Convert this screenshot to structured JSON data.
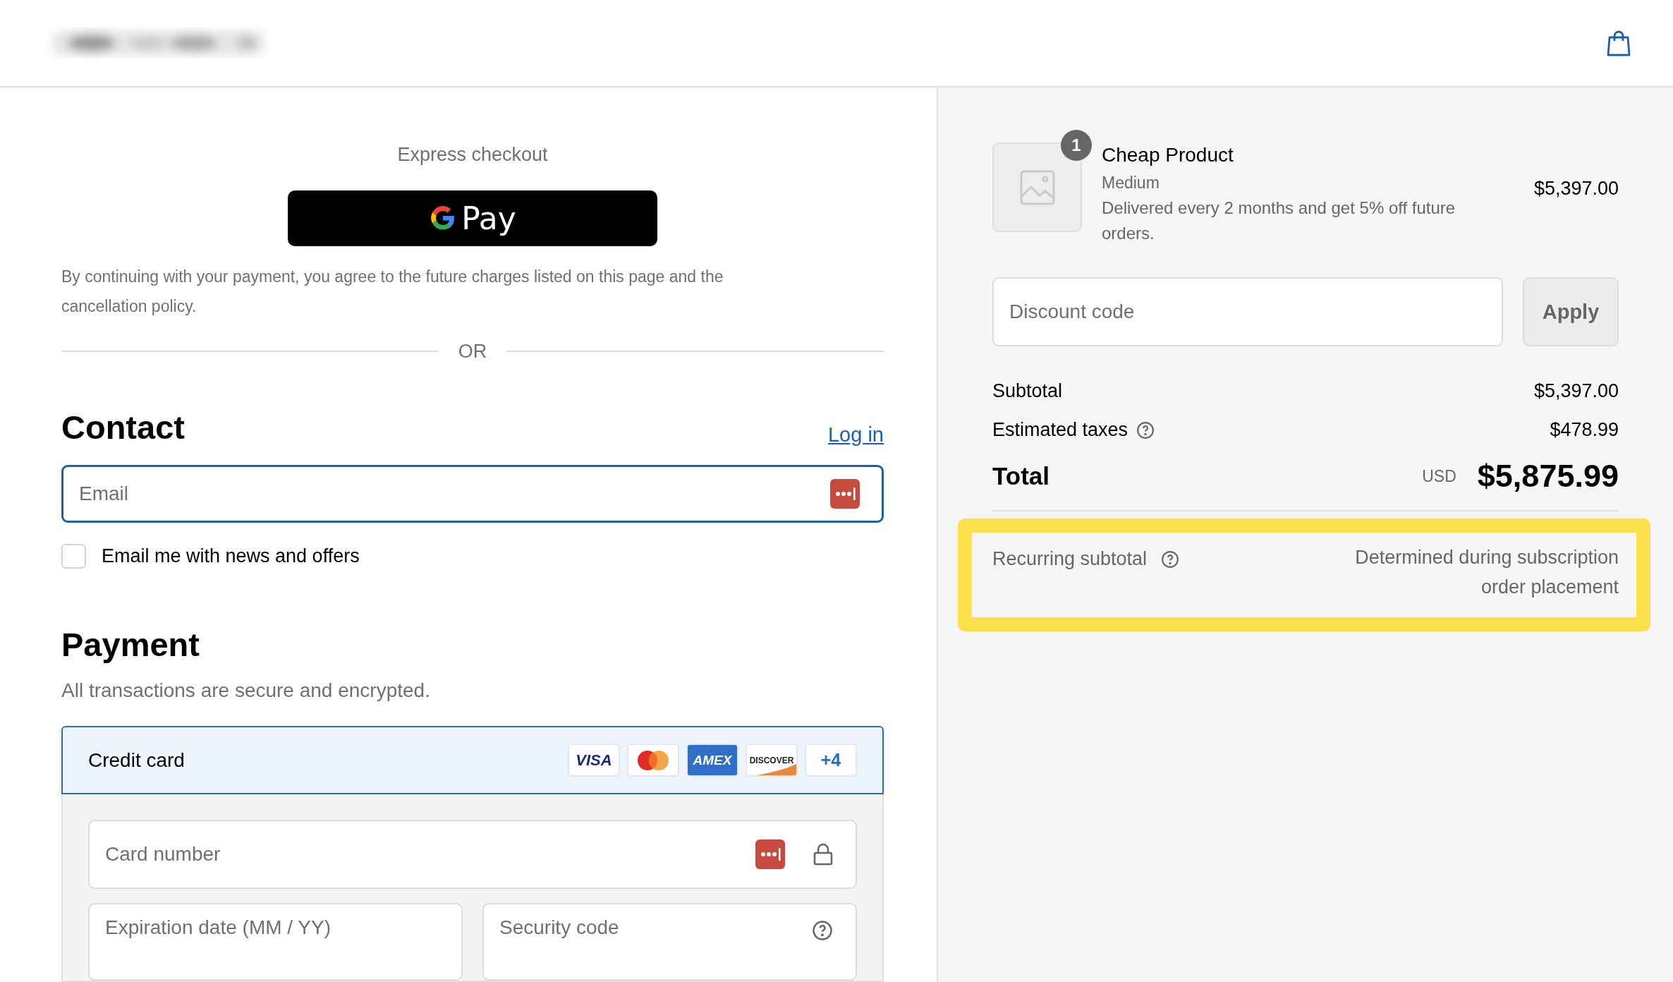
{
  "express": {
    "title": "Express checkout",
    "wallet_label": "Pay",
    "disclaimer": "By continuing with your payment, you agree to the future charges listed on this page and the cancellation policy.",
    "divider": "OR"
  },
  "contact": {
    "heading": "Contact",
    "login_link": "Log in",
    "email": {
      "placeholder": "Email",
      "focused": true
    },
    "newsletter": {
      "label": "Email me with news and offers",
      "checked": false
    }
  },
  "payment": {
    "heading": "Payment",
    "subtitle": "All transactions are secure and encrypted.",
    "method": {
      "label": "Credit card",
      "selected": true
    },
    "brands": [
      {
        "kind": "visa",
        "label": "VISA"
      },
      {
        "kind": "mastercard"
      },
      {
        "kind": "amex",
        "label": "AMEX"
      },
      {
        "kind": "discover",
        "label": "DISCOVER"
      },
      {
        "kind": "more",
        "label": "+4"
      }
    ],
    "fields": [
      {
        "kind": "card_number",
        "placeholder": "Card number"
      },
      {
        "kind": "expiry",
        "placeholder": "Expiration date (MM / YY)"
      },
      {
        "kind": "security_code",
        "placeholder": "Security code"
      }
    ]
  },
  "summary": {
    "item": {
      "quantity": "1",
      "name": "Cheap Product",
      "variant": "Medium",
      "note": "Delivered every 2 months and get 5% off future orders.",
      "price": "$5,397.00"
    },
    "discount": {
      "placeholder": "Discount code",
      "button": "Apply"
    },
    "subtotal": {
      "label": "Subtotal",
      "value": "$5,397.00"
    },
    "taxes": {
      "label": "Estimated taxes",
      "value": "$478.99"
    },
    "total": {
      "label": "Total",
      "currency": "USD",
      "value": "$5,875.99"
    },
    "recurring": {
      "label": "Recurring subtotal",
      "value": "Determined during subscription order placement",
      "highlighted": true
    }
  }
}
